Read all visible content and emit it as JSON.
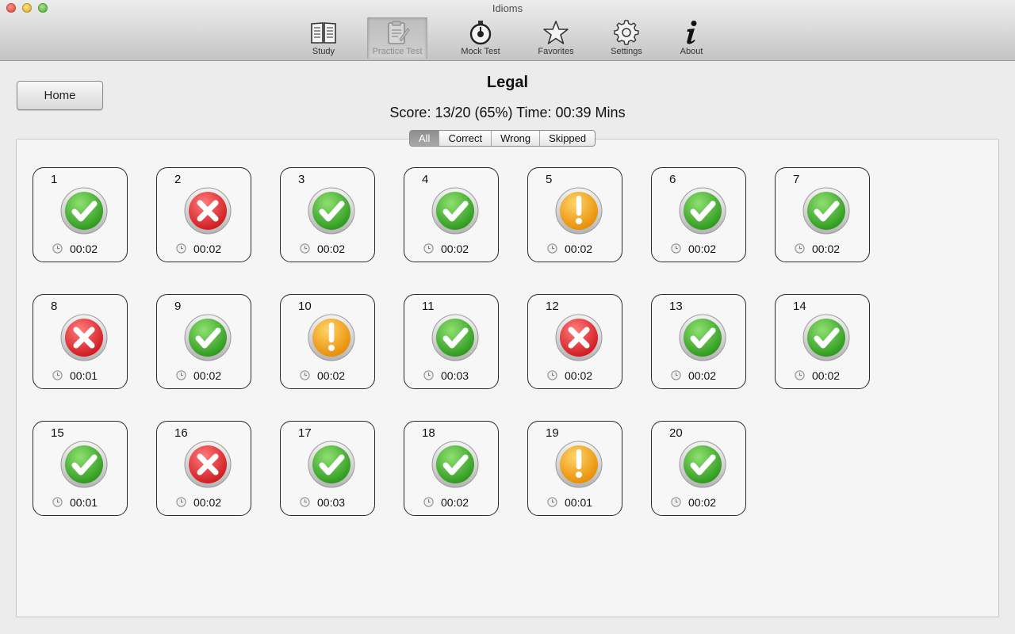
{
  "window": {
    "title": "Idioms"
  },
  "toolbar": {
    "items": [
      {
        "label": "Study",
        "icon": "book-icon"
      },
      {
        "label": "Practice Test",
        "icon": "clipboard-icon"
      },
      {
        "label": "Mock Test",
        "icon": "stopwatch-icon"
      },
      {
        "label": "Favorites",
        "icon": "star-icon"
      },
      {
        "label": "Settings",
        "icon": "gear-icon"
      },
      {
        "label": "About",
        "icon": "info-icon"
      }
    ],
    "active": "Practice Test"
  },
  "home_button": {
    "label": "Home"
  },
  "page": {
    "title": "Legal",
    "score": "Score: 13/20 (65%) Time: 00:39 Mins"
  },
  "filter": {
    "options": [
      "All",
      "Correct",
      "Wrong",
      "Skipped"
    ],
    "selected": "All"
  },
  "colors": {
    "correct": "#3aa52a",
    "wrong": "#e0282c",
    "skipped": "#f0a010"
  },
  "questions": [
    {
      "num": "1",
      "status": "correct",
      "time": "00:02"
    },
    {
      "num": "2",
      "status": "wrong",
      "time": "00:02"
    },
    {
      "num": "3",
      "status": "correct",
      "time": "00:02"
    },
    {
      "num": "4",
      "status": "correct",
      "time": "00:02"
    },
    {
      "num": "5",
      "status": "skipped",
      "time": "00:02"
    },
    {
      "num": "6",
      "status": "correct",
      "time": "00:02"
    },
    {
      "num": "7",
      "status": "correct",
      "time": "00:02"
    },
    {
      "num": "8",
      "status": "wrong",
      "time": "00:01"
    },
    {
      "num": "9",
      "status": "correct",
      "time": "00:02"
    },
    {
      "num": "10",
      "status": "skipped",
      "time": "00:02"
    },
    {
      "num": "11",
      "status": "correct",
      "time": "00:03"
    },
    {
      "num": "12",
      "status": "wrong",
      "time": "00:02"
    },
    {
      "num": "13",
      "status": "correct",
      "time": "00:02"
    },
    {
      "num": "14",
      "status": "correct",
      "time": "00:02"
    },
    {
      "num": "15",
      "status": "correct",
      "time": "00:01"
    },
    {
      "num": "16",
      "status": "wrong",
      "time": "00:02"
    },
    {
      "num": "17",
      "status": "correct",
      "time": "00:03"
    },
    {
      "num": "18",
      "status": "correct",
      "time": "00:02"
    },
    {
      "num": "19",
      "status": "skipped",
      "time": "00:01"
    },
    {
      "num": "20",
      "status": "correct",
      "time": "00:02"
    }
  ]
}
